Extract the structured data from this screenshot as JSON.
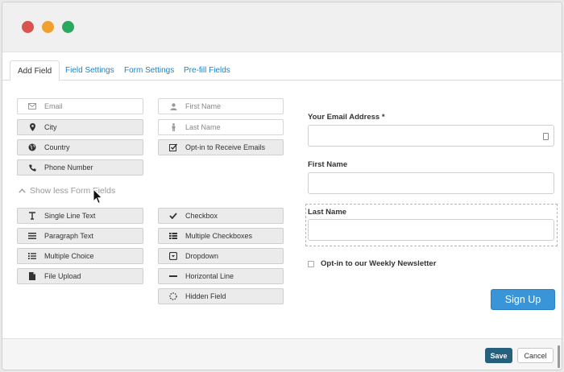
{
  "window": {
    "controls": [
      "close",
      "minimize",
      "maximize"
    ]
  },
  "tabs": [
    {
      "label": "Add Field",
      "active": true
    },
    {
      "label": "Field Settings",
      "active": false
    },
    {
      "label": "Form Settings",
      "active": false
    },
    {
      "label": "Pre-fill Fields",
      "active": false
    }
  ],
  "fields_top": {
    "email": "Email",
    "first_name": "First Name",
    "city": "City",
    "last_name": "Last Name",
    "country": "Country",
    "optin": "Opt-in to Receive Emails",
    "phone": "Phone Number"
  },
  "show_less": "Show less Form Fields",
  "fields_more": {
    "single_line": "Single Line Text",
    "checkbox": "Checkbox",
    "paragraph": "Paragraph Text",
    "multiple_checkboxes": "Multiple Checkboxes",
    "multiple_choice": "Multiple Choice",
    "dropdown": "Dropdown",
    "file_upload": "File Upload",
    "horizontal_line": "Horizontal Line",
    "hidden_field": "Hidden Field"
  },
  "form": {
    "email_label": "Your Email Address *",
    "first_name_label": "First Name",
    "last_name_label": "Last Name",
    "newsletter_label": "Opt-in to our Weekly Newsletter",
    "submit_label": "Sign Up"
  },
  "footer": {
    "save": "Save",
    "cancel": "Cancel"
  },
  "colors": {
    "link": "#1a84c7",
    "primary": "#3a95d8",
    "save": "#25617f",
    "selection_outline": "#f0b030",
    "dot_red": "#d9534f",
    "dot_orange": "#f0a030",
    "dot_green": "#2aa860"
  }
}
